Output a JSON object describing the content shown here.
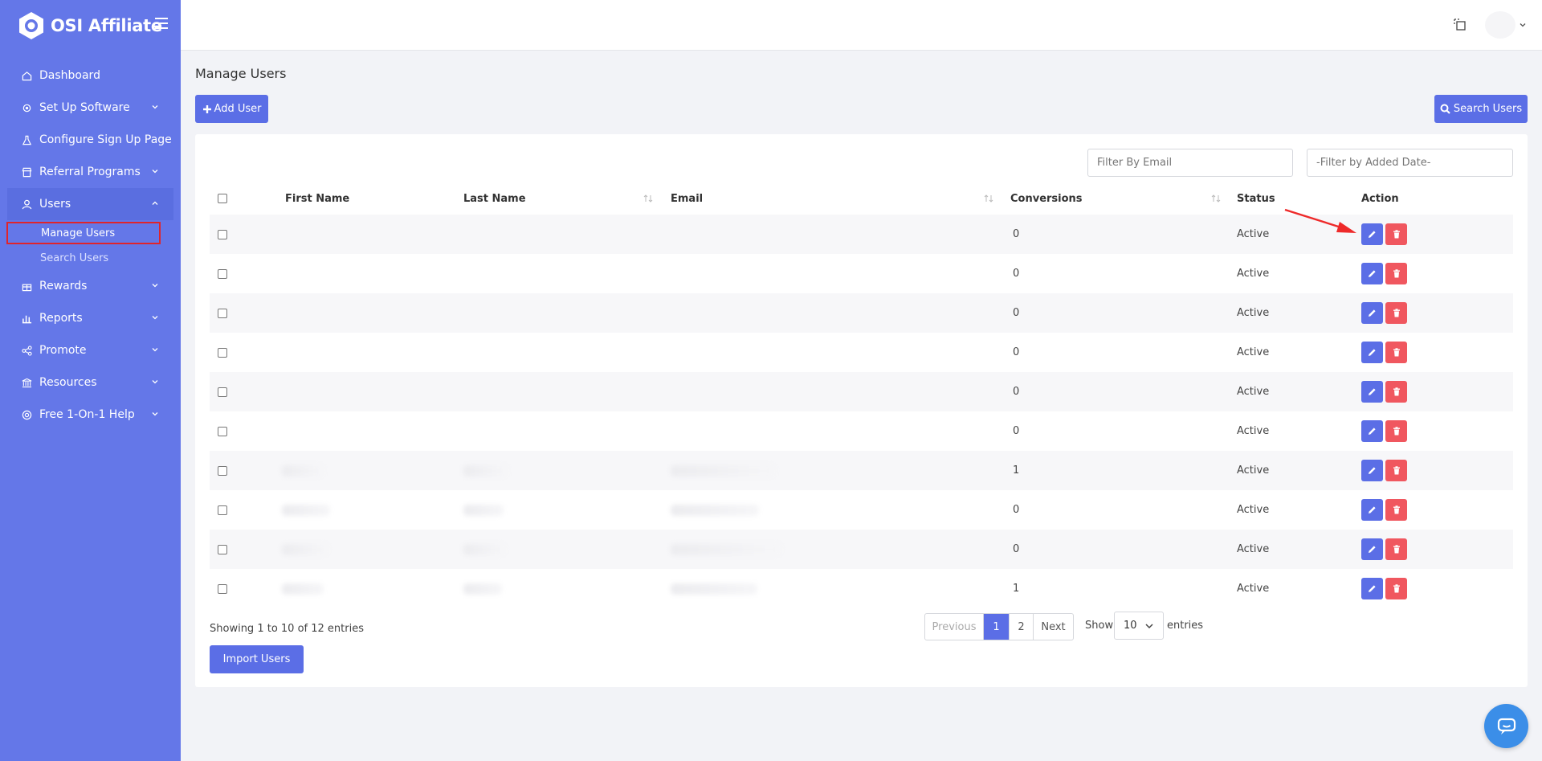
{
  "app": {
    "name": "OSI Affiliate"
  },
  "sidebar": {
    "items": [
      {
        "label": "Dashboard",
        "icon": "home-icon"
      },
      {
        "label": "Set Up Software",
        "icon": "gear-icon"
      },
      {
        "label": "Configure Sign Up Page",
        "icon": "flask-icon"
      },
      {
        "label": "Referral Programs",
        "icon": "store-icon"
      },
      {
        "label": "Users",
        "icon": "user-icon"
      },
      {
        "label": "Rewards",
        "icon": "gift-icon"
      },
      {
        "label": "Reports",
        "icon": "chart-icon"
      },
      {
        "label": "Promote",
        "icon": "share-icon"
      },
      {
        "label": "Resources",
        "icon": "library-icon"
      },
      {
        "label": "Free 1-On-1 Help",
        "icon": "lifebuoy-icon"
      }
    ],
    "users_sub": [
      "Manage Users",
      "Search Users"
    ]
  },
  "page": {
    "title": "Manage Users"
  },
  "toolbar": {
    "add_label": "Add User",
    "search_label": "Search Users"
  },
  "filters": {
    "email_placeholder": "Filter By Email",
    "date_placeholder": "-Filter by Added Date-"
  },
  "table": {
    "headers": [
      "First Name",
      "Last Name",
      "Email",
      "Conversions",
      "Status",
      "Action"
    ],
    "rows": [
      {
        "conversions": "0",
        "status": "Active"
      },
      {
        "conversions": "0",
        "status": "Active"
      },
      {
        "conversions": "0",
        "status": "Active"
      },
      {
        "conversions": "0",
        "status": "Active"
      },
      {
        "conversions": "0",
        "status": "Active"
      },
      {
        "conversions": "0",
        "status": "Active"
      },
      {
        "conversions": "1",
        "status": "Active"
      },
      {
        "conversions": "0",
        "status": "Active"
      },
      {
        "conversions": "0",
        "status": "Active"
      },
      {
        "conversions": "1",
        "status": "Active"
      }
    ]
  },
  "footer": {
    "showing": "Showing 1 to 10 of 12 entries",
    "previous": "Previous",
    "page1": "1",
    "page2": "2",
    "next": "Next",
    "show": "Show",
    "page_size": "10",
    "entries": "entries",
    "import_label": "Import Users"
  },
  "colors": {
    "sidebar": "#6477e8",
    "primary": "#5b6ee6",
    "danger": "#f0575f",
    "highlight": "#e0242b"
  }
}
